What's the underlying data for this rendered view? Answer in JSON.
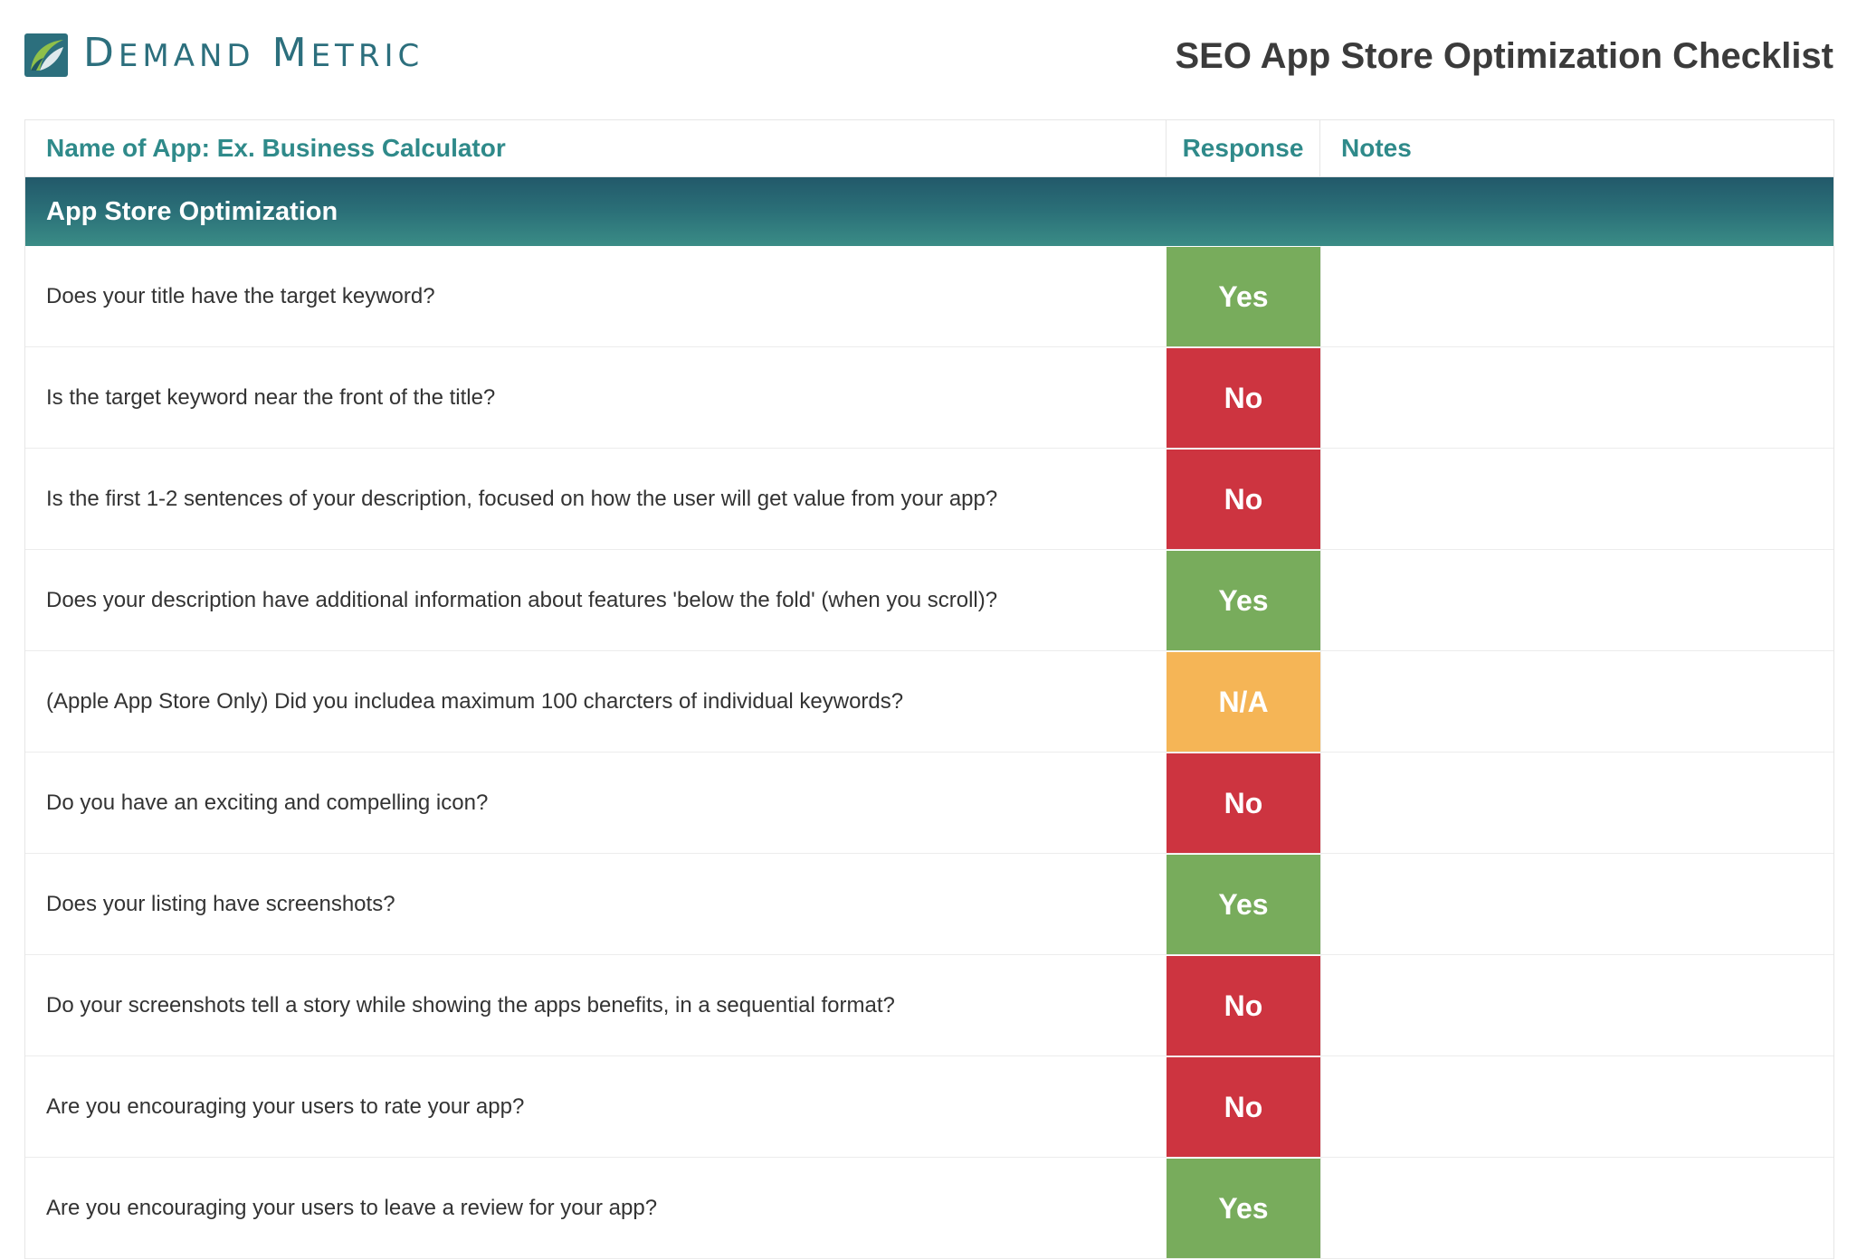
{
  "brand": {
    "logo_text": "Demand Metric"
  },
  "title": "SEO App Store Optimization Checklist",
  "table": {
    "columns": {
      "name": "Name of App: Ex. Business Calculator",
      "response": "Response",
      "notes": "Notes"
    },
    "section_title": "App Store Optimization",
    "colors": {
      "yes": "#78ac5c",
      "no": "#cd3440",
      "na": "#f5b556",
      "accent": "#2f8a8a"
    },
    "rows": [
      {
        "question": "Does your title have the target keyword?",
        "response": "Yes",
        "notes": ""
      },
      {
        "question": "Is the target keyword near the front of the title?",
        "response": "No",
        "notes": ""
      },
      {
        "question": "Is the first 1-2 sentences of your description, focused on how the user will get value from your app?",
        "response": "No",
        "notes": ""
      },
      {
        "question": "Does your description have additional information about features 'below the fold' (when you scroll)?",
        "response": "Yes",
        "notes": ""
      },
      {
        "question": "(Apple App Store Only) Did you includea maximum 100 charcters of individual keywords?",
        "response": "N/A",
        "notes": ""
      },
      {
        "question": "Do you have an exciting and compelling icon?",
        "response": "No",
        "notes": ""
      },
      {
        "question": "Does your listing have screenshots?",
        "response": "Yes",
        "notes": ""
      },
      {
        "question": "Do your screenshots tell a story while showing the apps benefits, in a sequential format?",
        "response": "No",
        "notes": ""
      },
      {
        "question": "Are you encouraging your users to rate your app?",
        "response": "No",
        "notes": ""
      },
      {
        "question": "Are you encouraging your users to leave a review for your app?",
        "response": "Yes",
        "notes": ""
      }
    ]
  }
}
